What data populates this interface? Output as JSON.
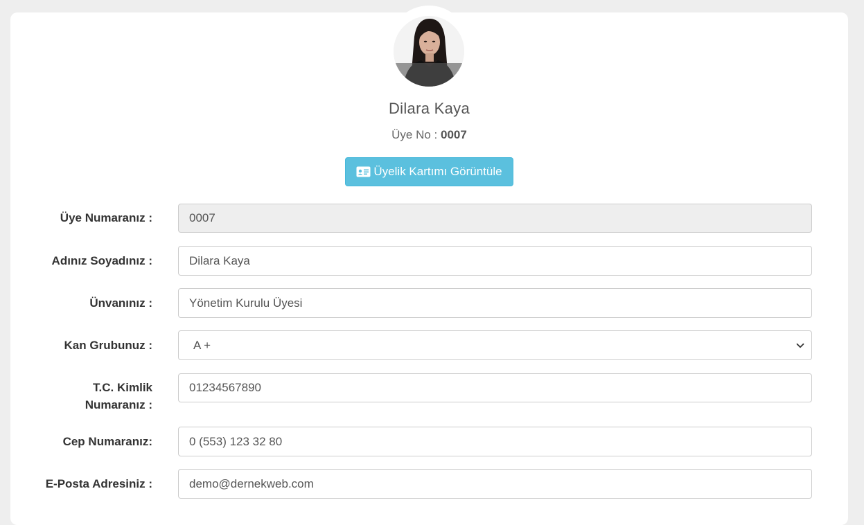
{
  "profile": {
    "name": "Dilara Kaya",
    "member_no_label": "Üye No :",
    "member_no_value": "0007",
    "card_button_label": "Üyelik Kartımı Görüntüle",
    "avatar_icon": "person-photo",
    "edit_icon": "edit-icon",
    "card_icon": "id-card-icon"
  },
  "form": {
    "member_number": {
      "label": "Üye Numaranız :",
      "value": "0007"
    },
    "full_name": {
      "label": "Adınız Soyadınız :",
      "value": "Dilara Kaya"
    },
    "title": {
      "label": "Ünvanınız :",
      "value": "Yönetim Kurulu Üyesi"
    },
    "blood_group": {
      "label": "Kan Grubunuz :",
      "value": "A +"
    },
    "tc_id": {
      "label_line1": "T.C. Kimlik",
      "label_line2": "Numaranız :",
      "value": "01234567890"
    },
    "phone": {
      "label": "Cep Numaranız:",
      "value": "0 (553) 123 32 80"
    },
    "email": {
      "label": "E-Posta Adresiniz :",
      "value": "demo@dernekweb.com"
    }
  },
  "colors": {
    "page_bg": "#eeeeee",
    "card_bg": "#ffffff",
    "info_button": "#5bc0de",
    "readonly_bg": "#eeeeee",
    "input_border": "#cccccc"
  }
}
